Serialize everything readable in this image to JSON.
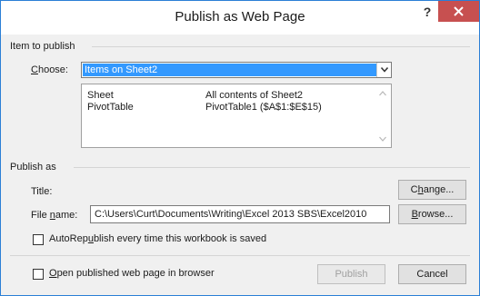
{
  "dialog": {
    "title": "Publish as Web Page",
    "help_label": "?",
    "close_icon": "close-icon"
  },
  "item_to_publish": {
    "section_label": "Item to publish",
    "choose_label_prefix": "",
    "choose_label_underlined": "C",
    "choose_label_rest": "hoose:",
    "choose_value": "Items on Sheet2",
    "items": [
      {
        "type": "Sheet",
        "description": "All contents of Sheet2"
      },
      {
        "type": "PivotTable",
        "description": "PivotTable1 ($A$1:$E$15)"
      }
    ]
  },
  "publish_as": {
    "section_label": "Publish as",
    "title_label": "Title:",
    "change_button_prefix": "C",
    "change_button_underlined": "h",
    "change_button_rest": "ange...",
    "file_name_label_prefix": "File ",
    "file_name_label_underlined": "n",
    "file_name_label_rest": "ame:",
    "file_name_value": "C:\\Users\\Curt\\Documents\\Writing\\Excel 2013 SBS\\Excel2010",
    "browse_button_underlined": "B",
    "browse_button_rest": "rowse...",
    "autorepublish_prefix": "AutoRep",
    "autorepublish_underlined": "u",
    "autorepublish_rest": "blish every time this workbook is saved",
    "autorepublish_checked": false
  },
  "footer": {
    "open_in_browser_underlined": "O",
    "open_in_browser_rest": "pen published web page in browser",
    "open_in_browser_checked": false,
    "publish_button": "Publish",
    "cancel_button": "Cancel"
  }
}
